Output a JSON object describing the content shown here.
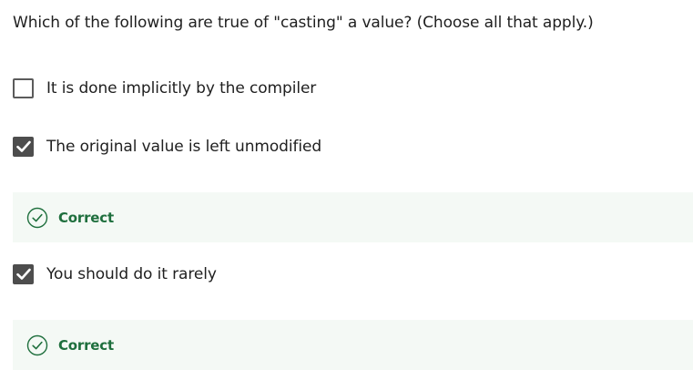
{
  "question": {
    "text": "Which of the following are true of \"casting\" a value? (Choose all that apply.)"
  },
  "options": [
    {
      "label": "It is done implicitly by the compiler",
      "checked": false
    },
    {
      "label": "The original value is left unmodified",
      "checked": true,
      "feedback": "Correct"
    },
    {
      "label": "You should do it rarely",
      "checked": true,
      "feedback": "Correct"
    }
  ],
  "colors": {
    "checkbox_checked": "#4d4d4d",
    "feedback_bg": "#f4f9f5",
    "feedback_text": "#1e6f3d"
  },
  "icons": {
    "checkbox_check": "checkmark-icon",
    "feedback": "check-circle-icon"
  }
}
